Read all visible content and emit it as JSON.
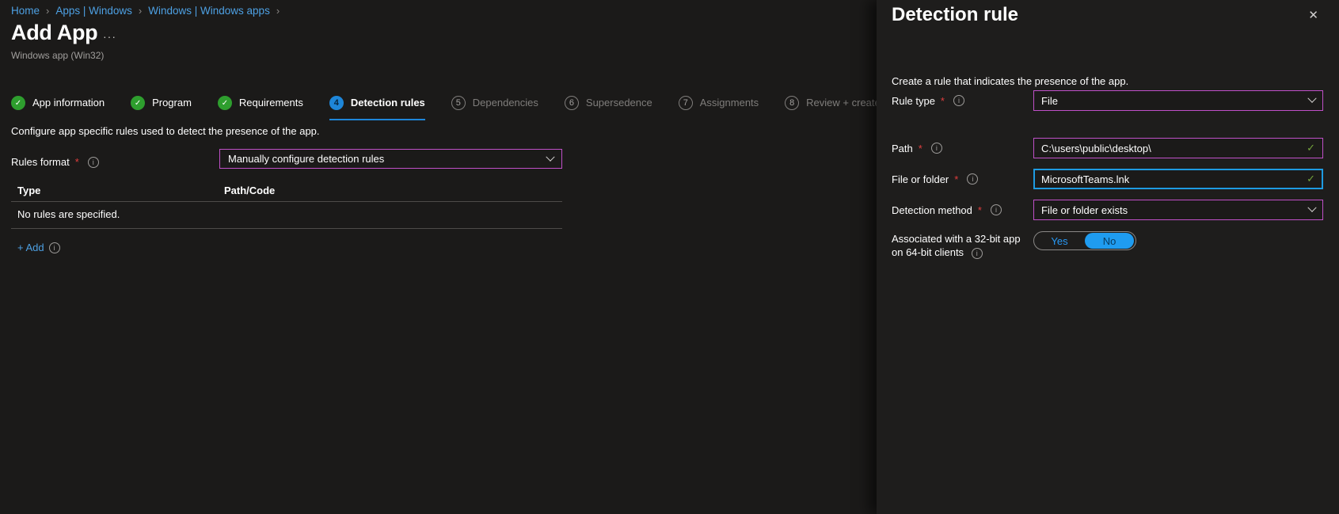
{
  "ui": {
    "breadcrumb_separator": "›",
    "required_marker": "*",
    "info_glyph": "i",
    "check_glyph": "✓",
    "close_glyph": "✕",
    "ellipsis": "···"
  },
  "colors": {
    "background": "#1b1a19",
    "panel_background": "#1e1d1c",
    "link_blue": "#4da0e3",
    "active_step_blue": "#1e86d9",
    "done_step_green": "#2e9e2e",
    "input_border_purple": "#c050c8",
    "focused_border_blue": "#1e9be2",
    "valid_check_green": "#74a43c",
    "toggle_fill_blue": "#1f9cf0",
    "required_red": "#e03e3e"
  },
  "breadcrumb": {
    "items": [
      "Home",
      "Apps | Windows",
      "Windows | Windows apps"
    ]
  },
  "header": {
    "title": "Add App",
    "subtitle": "Windows app (Win32)"
  },
  "wizard": {
    "steps": [
      {
        "number": "1",
        "label": "App information",
        "state": "done"
      },
      {
        "number": "2",
        "label": "Program",
        "state": "done"
      },
      {
        "number": "3",
        "label": "Requirements",
        "state": "done"
      },
      {
        "number": "4",
        "label": "Detection rules",
        "state": "active"
      },
      {
        "number": "5",
        "label": "Dependencies",
        "state": "upcoming"
      },
      {
        "number": "6",
        "label": "Supersedence",
        "state": "upcoming"
      },
      {
        "number": "7",
        "label": "Assignments",
        "state": "upcoming"
      },
      {
        "number": "8",
        "label": "Review + create",
        "state": "upcoming"
      }
    ]
  },
  "main": {
    "description": "Configure app specific rules used to detect the presence of the app.",
    "rules_format": {
      "label": "Rules format",
      "value": "Manually configure detection rules"
    },
    "rules_table": {
      "columns": [
        "Type",
        "Path/Code"
      ],
      "empty_message": "No rules are specified."
    },
    "add_label": "+ Add"
  },
  "panel": {
    "title": "Detection rule",
    "description": "Create a rule that indicates the presence of the app.",
    "fields": {
      "rule_type": {
        "label": "Rule type",
        "value": "File"
      },
      "path": {
        "label": "Path",
        "value": "C:\\users\\public\\desktop\\"
      },
      "file_or_folder": {
        "label": "File or folder",
        "value": "MicrosoftTeams.lnk"
      },
      "detection_method": {
        "label": "Detection method",
        "value": "File or folder exists"
      },
      "associated_32bit": {
        "label_line1": "Associated with a 32-bit app",
        "label_line2": "on 64-bit clients",
        "options": {
          "yes": "Yes",
          "no": "No"
        },
        "value": "No"
      }
    }
  }
}
